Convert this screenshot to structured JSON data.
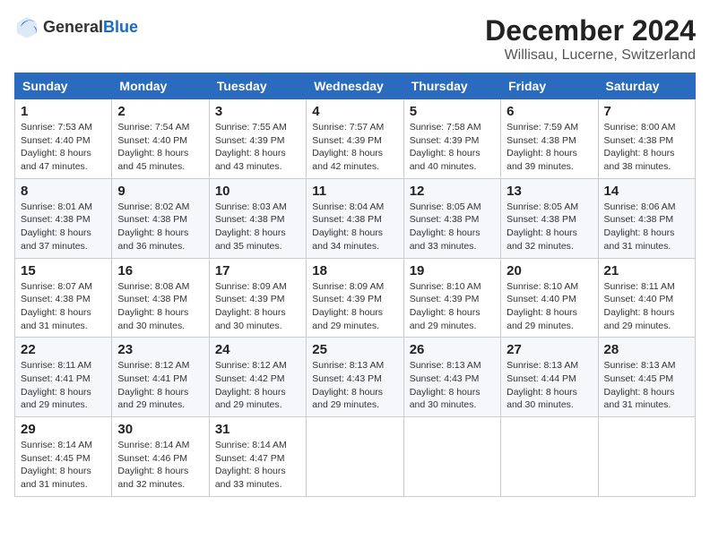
{
  "header": {
    "logo_general": "General",
    "logo_blue": "Blue",
    "month_title": "December 2024",
    "location": "Willisau, Lucerne, Switzerland"
  },
  "weekdays": [
    "Sunday",
    "Monday",
    "Tuesday",
    "Wednesday",
    "Thursday",
    "Friday",
    "Saturday"
  ],
  "weeks": [
    [
      {
        "day": "1",
        "sunrise": "Sunrise: 7:53 AM",
        "sunset": "Sunset: 4:40 PM",
        "daylight": "Daylight: 8 hours and 47 minutes."
      },
      {
        "day": "2",
        "sunrise": "Sunrise: 7:54 AM",
        "sunset": "Sunset: 4:40 PM",
        "daylight": "Daylight: 8 hours and 45 minutes."
      },
      {
        "day": "3",
        "sunrise": "Sunrise: 7:55 AM",
        "sunset": "Sunset: 4:39 PM",
        "daylight": "Daylight: 8 hours and 43 minutes."
      },
      {
        "day": "4",
        "sunrise": "Sunrise: 7:57 AM",
        "sunset": "Sunset: 4:39 PM",
        "daylight": "Daylight: 8 hours and 42 minutes."
      },
      {
        "day": "5",
        "sunrise": "Sunrise: 7:58 AM",
        "sunset": "Sunset: 4:39 PM",
        "daylight": "Daylight: 8 hours and 40 minutes."
      },
      {
        "day": "6",
        "sunrise": "Sunrise: 7:59 AM",
        "sunset": "Sunset: 4:38 PM",
        "daylight": "Daylight: 8 hours and 39 minutes."
      },
      {
        "day": "7",
        "sunrise": "Sunrise: 8:00 AM",
        "sunset": "Sunset: 4:38 PM",
        "daylight": "Daylight: 8 hours and 38 minutes."
      }
    ],
    [
      {
        "day": "8",
        "sunrise": "Sunrise: 8:01 AM",
        "sunset": "Sunset: 4:38 PM",
        "daylight": "Daylight: 8 hours and 37 minutes."
      },
      {
        "day": "9",
        "sunrise": "Sunrise: 8:02 AM",
        "sunset": "Sunset: 4:38 PM",
        "daylight": "Daylight: 8 hours and 36 minutes."
      },
      {
        "day": "10",
        "sunrise": "Sunrise: 8:03 AM",
        "sunset": "Sunset: 4:38 PM",
        "daylight": "Daylight: 8 hours and 35 minutes."
      },
      {
        "day": "11",
        "sunrise": "Sunrise: 8:04 AM",
        "sunset": "Sunset: 4:38 PM",
        "daylight": "Daylight: 8 hours and 34 minutes."
      },
      {
        "day": "12",
        "sunrise": "Sunrise: 8:05 AM",
        "sunset": "Sunset: 4:38 PM",
        "daylight": "Daylight: 8 hours and 33 minutes."
      },
      {
        "day": "13",
        "sunrise": "Sunrise: 8:05 AM",
        "sunset": "Sunset: 4:38 PM",
        "daylight": "Daylight: 8 hours and 32 minutes."
      },
      {
        "day": "14",
        "sunrise": "Sunrise: 8:06 AM",
        "sunset": "Sunset: 4:38 PM",
        "daylight": "Daylight: 8 hours and 31 minutes."
      }
    ],
    [
      {
        "day": "15",
        "sunrise": "Sunrise: 8:07 AM",
        "sunset": "Sunset: 4:38 PM",
        "daylight": "Daylight: 8 hours and 31 minutes."
      },
      {
        "day": "16",
        "sunrise": "Sunrise: 8:08 AM",
        "sunset": "Sunset: 4:38 PM",
        "daylight": "Daylight: 8 hours and 30 minutes."
      },
      {
        "day": "17",
        "sunrise": "Sunrise: 8:09 AM",
        "sunset": "Sunset: 4:39 PM",
        "daylight": "Daylight: 8 hours and 30 minutes."
      },
      {
        "day": "18",
        "sunrise": "Sunrise: 8:09 AM",
        "sunset": "Sunset: 4:39 PM",
        "daylight": "Daylight: 8 hours and 29 minutes."
      },
      {
        "day": "19",
        "sunrise": "Sunrise: 8:10 AM",
        "sunset": "Sunset: 4:39 PM",
        "daylight": "Daylight: 8 hours and 29 minutes."
      },
      {
        "day": "20",
        "sunrise": "Sunrise: 8:10 AM",
        "sunset": "Sunset: 4:40 PM",
        "daylight": "Daylight: 8 hours and 29 minutes."
      },
      {
        "day": "21",
        "sunrise": "Sunrise: 8:11 AM",
        "sunset": "Sunset: 4:40 PM",
        "daylight": "Daylight: 8 hours and 29 minutes."
      }
    ],
    [
      {
        "day": "22",
        "sunrise": "Sunrise: 8:11 AM",
        "sunset": "Sunset: 4:41 PM",
        "daylight": "Daylight: 8 hours and 29 minutes."
      },
      {
        "day": "23",
        "sunrise": "Sunrise: 8:12 AM",
        "sunset": "Sunset: 4:41 PM",
        "daylight": "Daylight: 8 hours and 29 minutes."
      },
      {
        "day": "24",
        "sunrise": "Sunrise: 8:12 AM",
        "sunset": "Sunset: 4:42 PM",
        "daylight": "Daylight: 8 hours and 29 minutes."
      },
      {
        "day": "25",
        "sunrise": "Sunrise: 8:13 AM",
        "sunset": "Sunset: 4:43 PM",
        "daylight": "Daylight: 8 hours and 29 minutes."
      },
      {
        "day": "26",
        "sunrise": "Sunrise: 8:13 AM",
        "sunset": "Sunset: 4:43 PM",
        "daylight": "Daylight: 8 hours and 30 minutes."
      },
      {
        "day": "27",
        "sunrise": "Sunrise: 8:13 AM",
        "sunset": "Sunset: 4:44 PM",
        "daylight": "Daylight: 8 hours and 30 minutes."
      },
      {
        "day": "28",
        "sunrise": "Sunrise: 8:13 AM",
        "sunset": "Sunset: 4:45 PM",
        "daylight": "Daylight: 8 hours and 31 minutes."
      }
    ],
    [
      {
        "day": "29",
        "sunrise": "Sunrise: 8:14 AM",
        "sunset": "Sunset: 4:45 PM",
        "daylight": "Daylight: 8 hours and 31 minutes."
      },
      {
        "day": "30",
        "sunrise": "Sunrise: 8:14 AM",
        "sunset": "Sunset: 4:46 PM",
        "daylight": "Daylight: 8 hours and 32 minutes."
      },
      {
        "day": "31",
        "sunrise": "Sunrise: 8:14 AM",
        "sunset": "Sunset: 4:47 PM",
        "daylight": "Daylight: 8 hours and 33 minutes."
      },
      null,
      null,
      null,
      null
    ]
  ]
}
